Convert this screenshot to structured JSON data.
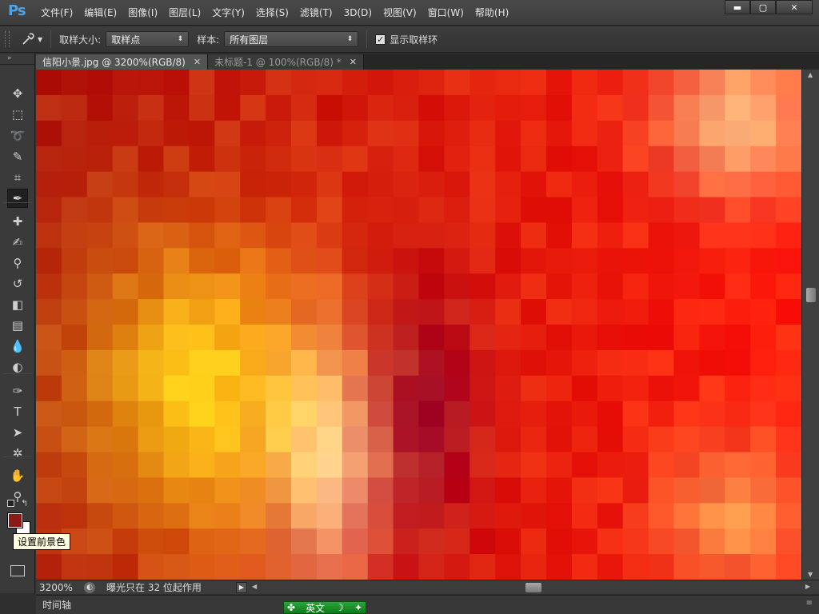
{
  "app": {
    "logo": "Ps"
  },
  "menu": [
    "文件(F)",
    "编辑(E)",
    "图像(I)",
    "图层(L)",
    "文字(Y)",
    "选择(S)",
    "滤镜(T)",
    "3D(D)",
    "视图(V)",
    "窗口(W)",
    "帮助(H)"
  ],
  "window_buttons": {
    "minimize": "▬",
    "maximize": "▢",
    "close": "✕"
  },
  "options": {
    "sample_size_label": "取样大小:",
    "sample_size_value": "取样点",
    "sample_label": "样本:",
    "sample_value": "所有图层",
    "show_ring_label": "显示取样环",
    "show_ring_checked": true
  },
  "tabs": [
    {
      "label": "信阳小景.jpg @ 3200%(RGB/8)",
      "active": true
    },
    {
      "label": "未标题-1 @ 100%(RGB/8) *",
      "active": false
    }
  ],
  "tools": [
    "move-icon",
    "marquee-icon",
    "lasso-icon",
    "quick-select-icon",
    "crop-icon",
    "eyedropper-icon",
    "healing-icon",
    "brush-icon",
    "stamp-icon",
    "history-brush-icon",
    "eraser-icon",
    "gradient-icon",
    "blur-icon",
    "dodge-icon",
    "pen-icon",
    "type-icon",
    "path-select-icon",
    "shape-icon",
    "hand-icon",
    "zoom-icon"
  ],
  "colors": {
    "foreground": "#8b1a16",
    "background": "#ffffff"
  },
  "tooltip": "设置前景色",
  "status": {
    "zoom": "3200%",
    "info": "曝光只在 32 位起作用"
  },
  "timeline": "时间轴",
  "ime": {
    "label": "英文"
  }
}
